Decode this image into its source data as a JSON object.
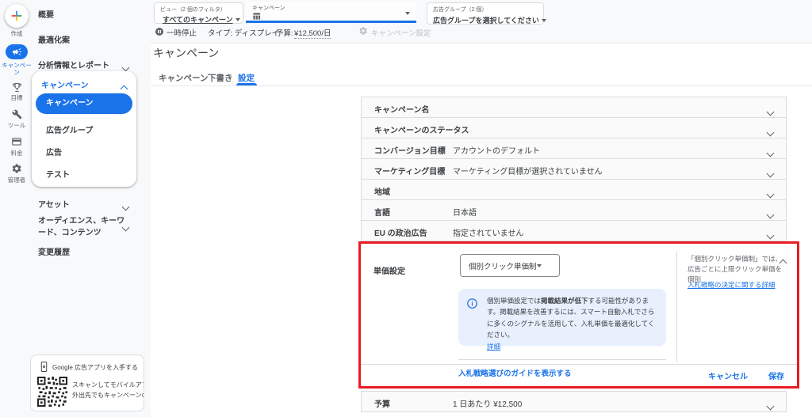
{
  "colors": {
    "accent_blue": "#1a73e8",
    "info_icon_blue": "#1967d2",
    "info_box_bg": "#e8f0fe",
    "annotation_red": "#ea1b22",
    "chrome_bg": "#f8f9fa",
    "text_dark": "#3c4043",
    "text_gray": "#5f6368"
  },
  "rail": {
    "create": {
      "label": "作成"
    },
    "items": [
      {
        "label": "キャンペーン",
        "active": true
      },
      {
        "label": "目標"
      },
      {
        "label": "ツール"
      },
      {
        "label": "料金"
      },
      {
        "label": "管理者"
      }
    ]
  },
  "sidebar": {
    "overview": "概要",
    "recommendations": "最適化案",
    "insights": "分析情報とレポート",
    "campaign_group": {
      "header": "キャンペーン",
      "selected": "キャンペーン",
      "items": [
        "広告グループ",
        "広告",
        "テスト"
      ]
    },
    "assets": "アセット",
    "audiences": "オーディエンス、キーワード、コンテンツ",
    "change_history": "変更履歴",
    "promo": {
      "title": "Google 広告アプリを入手する",
      "line1": "スキャンしてモバイルアプリを",
      "line2": "外出先でもキャンペーンの最"
    }
  },
  "topbar": {
    "view": {
      "label": "ビュー（2 個のフィルタ）",
      "value": "すべてのキャンペーン"
    },
    "campaign_field": {
      "label": "キャンペーン"
    },
    "adgroup": {
      "label": "広告グループ（2 個）",
      "value": "広告グループを選択してください"
    },
    "status": {
      "state": "一時停止",
      "type": "タイプ: ディスプレイ",
      "budget_label": "予算:",
      "budget_value": "¥12,500/日",
      "settings": "キャンペーン設定"
    }
  },
  "main": {
    "title": "キャンペーン",
    "tabs": [
      {
        "label": "キャンペーン"
      },
      {
        "label": "下書き"
      },
      {
        "label": "設定",
        "active": true
      }
    ],
    "panels": [
      {
        "label": "キャンペーン名",
        "value": ""
      },
      {
        "label": "キャンペーンのステータス",
        "value": ""
      },
      {
        "label": "コンバージョン目標",
        "value": "アカウントのデフォルト"
      },
      {
        "label": "マーケティング目標",
        "value": "マーケティング目標が選択されていません"
      },
      {
        "label": "地域",
        "value": ""
      },
      {
        "label": "言語",
        "value": "日本語"
      },
      {
        "label": "EU の政治広告",
        "value": "指定されていません"
      }
    ],
    "bidding": {
      "label": "単価設定",
      "strategy_value": "個別クリック単価制",
      "warning": {
        "pre": "個別単価設定では",
        "bold": "掲載結果が低下",
        "post": "する可能性があります。掲載結果を改善するには、スマート自動入札でさらに多くのシグナルを活用して、入札単価を最適化してください。",
        "link": "詳細"
      },
      "guide_link": "入札戦略選びのガイドを表示する",
      "side_note": {
        "line1": "「個別クリック単価制」では、",
        "line2": "広告ごとに上限クリック単価を個別",
        "link": "入札戦略の決定に関する詳細"
      },
      "cancel_label": "キャンセル",
      "save_label": "保存"
    },
    "budget": {
      "label": "予算",
      "value": "1 日あたり ¥12,500"
    }
  }
}
